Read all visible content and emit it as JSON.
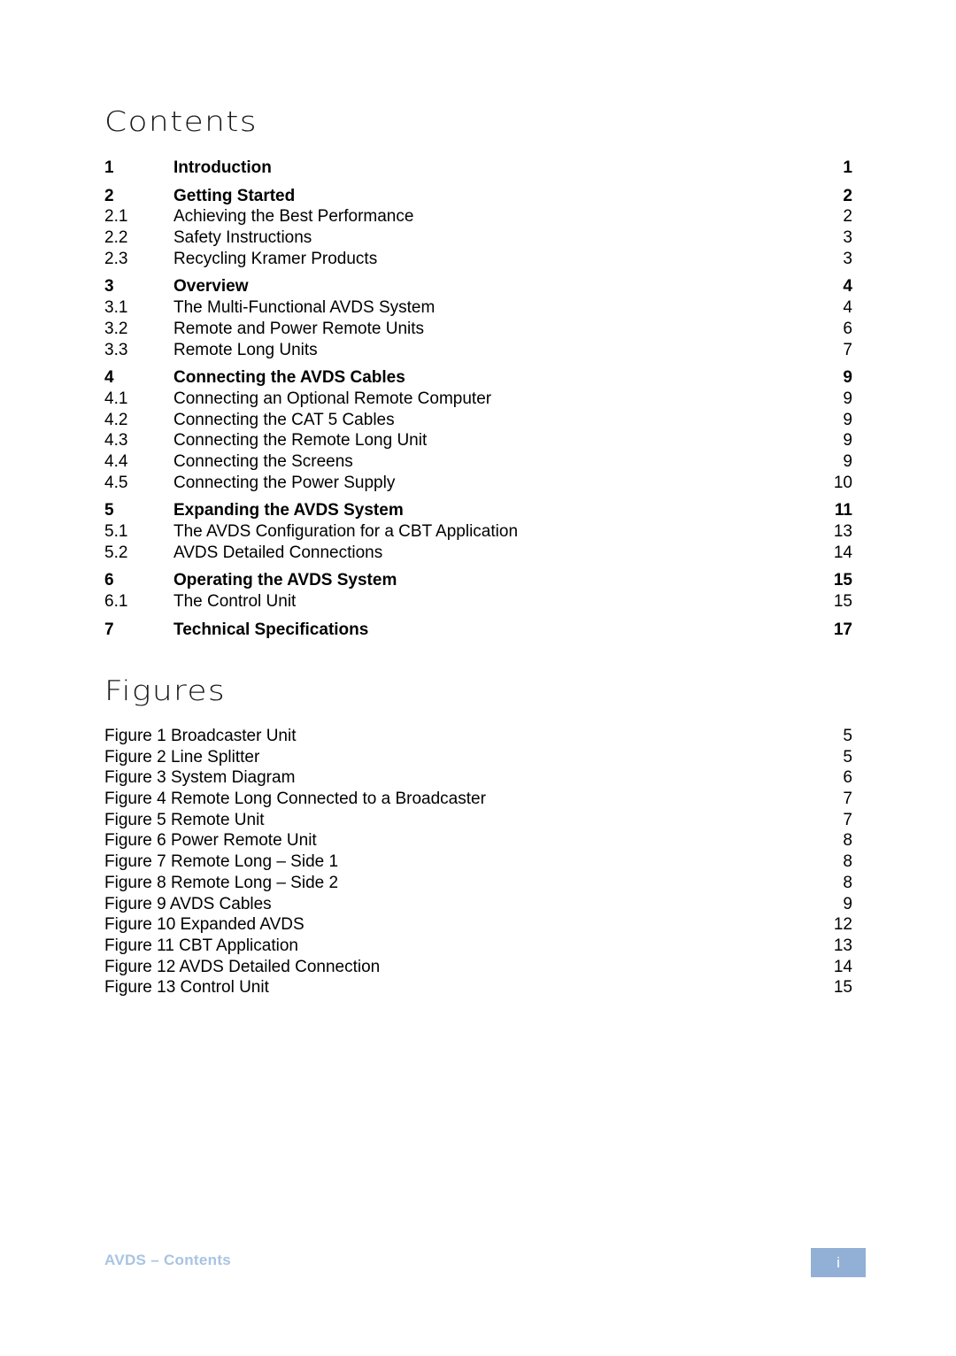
{
  "headings": {
    "contents": "Contents",
    "figures": "Figures"
  },
  "toc": [
    {
      "num": "1",
      "title": "Introduction",
      "page": "1",
      "level": "section"
    },
    {
      "num": "2",
      "title": "Getting Started",
      "page": "2",
      "level": "section"
    },
    {
      "num": "2.1",
      "title": "Achieving the Best Performance",
      "page": "2",
      "level": "sub"
    },
    {
      "num": "2.2",
      "title": "Safety Instructions",
      "page": "3",
      "level": "sub"
    },
    {
      "num": "2.3",
      "title": "Recycling Kramer Products",
      "page": "3",
      "level": "sub"
    },
    {
      "num": "3",
      "title": "Overview",
      "page": "4",
      "level": "section"
    },
    {
      "num": "3.1",
      "title": "The Multi-Functional AVDS System",
      "page": "4",
      "level": "sub"
    },
    {
      "num": "3.2",
      "title": "Remote and Power Remote Units",
      "page": "6",
      "level": "sub"
    },
    {
      "num": "3.3",
      "title": "Remote Long Units",
      "page": "7",
      "level": "sub"
    },
    {
      "num": "4",
      "title": "Connecting the AVDS Cables",
      "page": "9",
      "level": "section"
    },
    {
      "num": "4.1",
      "title": "Connecting an Optional Remote Computer",
      "page": "9",
      "level": "sub"
    },
    {
      "num": "4.2",
      "title": "Connecting the CAT 5 Cables",
      "page": "9",
      "level": "sub"
    },
    {
      "num": "4.3",
      "title": "Connecting the Remote Long Unit",
      "page": "9",
      "level": "sub"
    },
    {
      "num": "4.4",
      "title": "Connecting the Screens",
      "page": "9",
      "level": "sub"
    },
    {
      "num": "4.5",
      "title": "Connecting the Power Supply",
      "page": "10",
      "level": "sub"
    },
    {
      "num": "5",
      "title": "Expanding the AVDS System",
      "page": "11",
      "level": "section"
    },
    {
      "num": "5.1",
      "title": "The AVDS Configuration for a CBT Application",
      "page": "13",
      "level": "sub"
    },
    {
      "num": "5.2",
      "title": "AVDS Detailed Connections",
      "page": "14",
      "level": "sub"
    },
    {
      "num": "6",
      "title": "Operating the AVDS System",
      "page": "15",
      "level": "section"
    },
    {
      "num": "6.1",
      "title": "The Control Unit",
      "page": "15",
      "level": "sub"
    },
    {
      "num": "7",
      "title": "Technical Specifications",
      "page": "17",
      "level": "section"
    }
  ],
  "figures": [
    {
      "label": "Figure 1 Broadcaster Unit",
      "page": "5"
    },
    {
      "label": "Figure 2 Line Splitter",
      "page": "5"
    },
    {
      "label": "Figure 3 System Diagram",
      "page": "6"
    },
    {
      "label": "Figure 4 Remote Long Connected to a Broadcaster",
      "page": "7"
    },
    {
      "label": "Figure 5 Remote Unit",
      "page": "7"
    },
    {
      "label": "Figure 6 Power Remote Unit",
      "page": "8"
    },
    {
      "label": "Figure 7 Remote Long – Side 1",
      "page": "8"
    },
    {
      "label": "Figure 8 Remote Long – Side 2",
      "page": "8"
    },
    {
      "label": "Figure 9 AVDS Cables",
      "page": "9"
    },
    {
      "label": "Figure 10 Expanded AVDS",
      "page": "12"
    },
    {
      "label": "Figure 11 CBT Application",
      "page": "13"
    },
    {
      "label": "Figure 12 AVDS Detailed Connection",
      "page": "14"
    },
    {
      "label": "Figure 13 Control Unit",
      "page": "15"
    }
  ],
  "footer": {
    "text": "AVDS –  Contents",
    "page_label": "i",
    "text_color": "#a8c4e2",
    "box_color": "#92b0d5"
  }
}
